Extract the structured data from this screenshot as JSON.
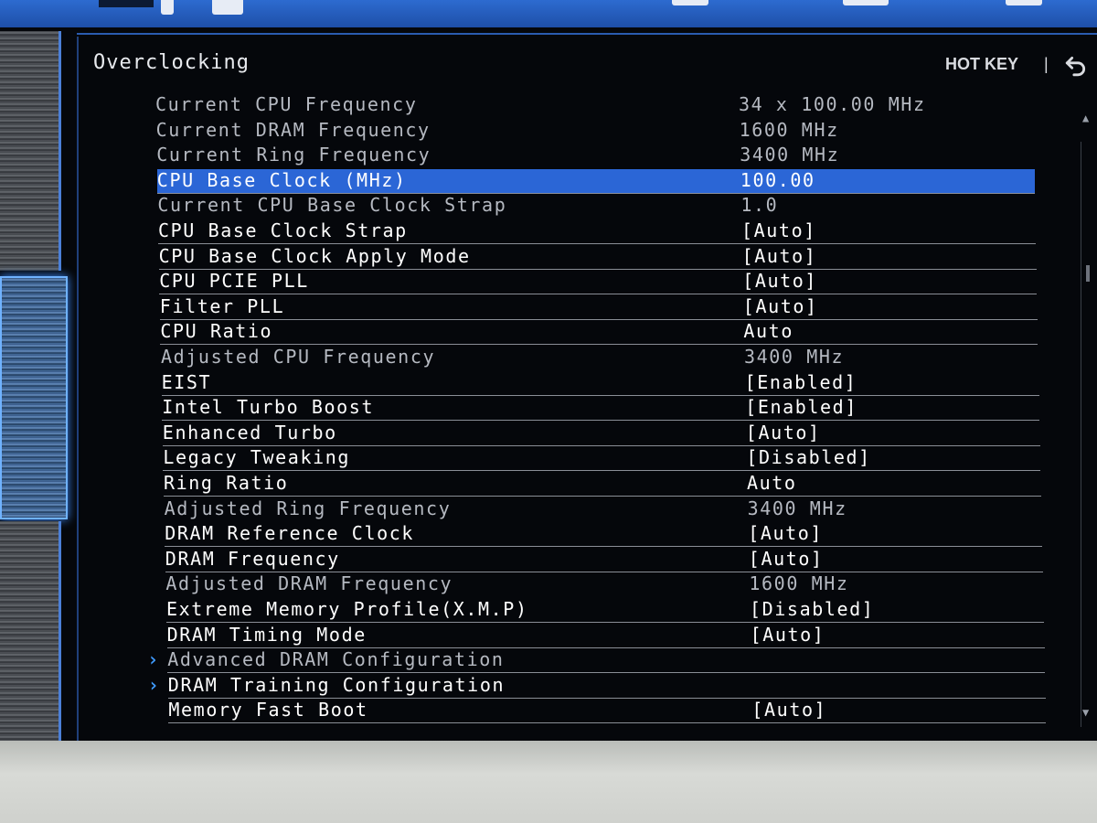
{
  "page_title": "Overclocking",
  "hotkey_label": "HOT KEY",
  "hotkey_separator": "|",
  "icons": {
    "back": "back-arrow-icon",
    "submenu": "chevron-right-icon",
    "scroll_up": "scroll-up-arrow-icon",
    "scroll_down": "scroll-down-arrow-icon"
  },
  "colors": {
    "accent": "#2b66d6",
    "submenu_chevron": "#3f9bff",
    "info_text": "#b5b9c1",
    "option_text": "#ffffff"
  },
  "settings": [
    {
      "label": "Current CPU Frequency",
      "value": "34 x 100.00 MHz",
      "kind": "info"
    },
    {
      "label": "Current DRAM Frequency",
      "value": "1600 MHz",
      "kind": "info"
    },
    {
      "label": "Current Ring Frequency",
      "value": "3400 MHz",
      "kind": "info"
    },
    {
      "label": "CPU Base Clock (MHz)",
      "value": "100.00",
      "kind": "selected"
    },
    {
      "label": "Current CPU Base Clock Strap",
      "value": "1.0",
      "kind": "info"
    },
    {
      "label": "CPU Base Clock Strap",
      "value": "[Auto]",
      "kind": "option"
    },
    {
      "label": "CPU Base Clock Apply Mode",
      "value": "[Auto]",
      "kind": "option"
    },
    {
      "label": "CPU PCIE PLL",
      "value": "[Auto]",
      "kind": "option"
    },
    {
      "label": "Filter PLL",
      "value": "[Auto]",
      "kind": "option"
    },
    {
      "label": "CPU Ratio",
      "value": "Auto",
      "kind": "option"
    },
    {
      "label": "Adjusted CPU Frequency",
      "value": "3400 MHz",
      "kind": "info"
    },
    {
      "label": "EIST",
      "value": "[Enabled]",
      "kind": "option"
    },
    {
      "label": "Intel Turbo Boost",
      "value": "[Enabled]",
      "kind": "option"
    },
    {
      "label": "Enhanced Turbo",
      "value": "[Auto]",
      "kind": "option"
    },
    {
      "label": "Legacy Tweaking",
      "value": "[Disabled]",
      "kind": "option"
    },
    {
      "label": "Ring Ratio",
      "value": "Auto",
      "kind": "option"
    },
    {
      "label": "Adjusted Ring Frequency",
      "value": "3400 MHz",
      "kind": "info"
    },
    {
      "label": "DRAM Reference Clock",
      "value": "[Auto]",
      "kind": "option"
    },
    {
      "label": "DRAM Frequency",
      "value": "[Auto]",
      "kind": "option"
    },
    {
      "label": "Adjusted DRAM Frequency",
      "value": "1600 MHz",
      "kind": "info"
    },
    {
      "label": "Extreme Memory Profile(X.M.P)",
      "value": "[Disabled]",
      "kind": "option"
    },
    {
      "label": "DRAM Timing Mode",
      "value": "[Auto]",
      "kind": "option"
    },
    {
      "label": "Advanced DRAM Configuration",
      "value": "",
      "kind": "submenu-dim"
    },
    {
      "label": "DRAM Training Configuration",
      "value": "",
      "kind": "submenu"
    },
    {
      "label": "Memory Fast Boot",
      "value": "[Auto]",
      "kind": "option"
    }
  ]
}
